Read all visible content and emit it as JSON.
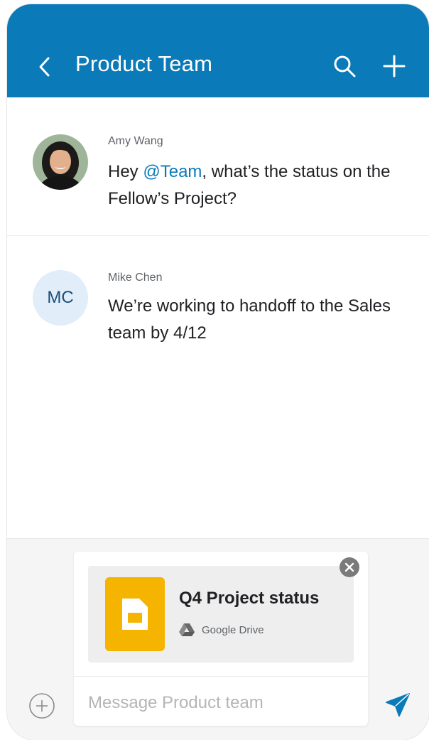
{
  "header": {
    "title": "Product Team",
    "background_color": "#0a7ab8",
    "back_icon": "chevron-left-icon",
    "search_icon": "search-icon",
    "add_icon": "plus-icon"
  },
  "messages": [
    {
      "sender": "Amy Wang",
      "avatar": "photo",
      "text_before": "Hey ",
      "mention": "@Team",
      "text_after": ", what’s the status on the Fellow’s Project?"
    },
    {
      "sender": "Mike Chen",
      "avatar_initials": "MC",
      "text": "We’re working to handoff to the Sales team by 4/12"
    }
  ],
  "composer": {
    "attachment": {
      "file_name": "Q4 Project status",
      "source": "Google Drive",
      "file_icon": "google-slides-icon",
      "source_icon": "google-drive-icon",
      "remove_icon": "close-icon"
    },
    "placeholder": "Message Product team",
    "add_icon": "plus-circle-icon",
    "send_icon": "send-icon"
  },
  "colors": {
    "accent": "#0a7ab8",
    "mention": "#0a7ab8",
    "file_icon": "#f4b400"
  }
}
